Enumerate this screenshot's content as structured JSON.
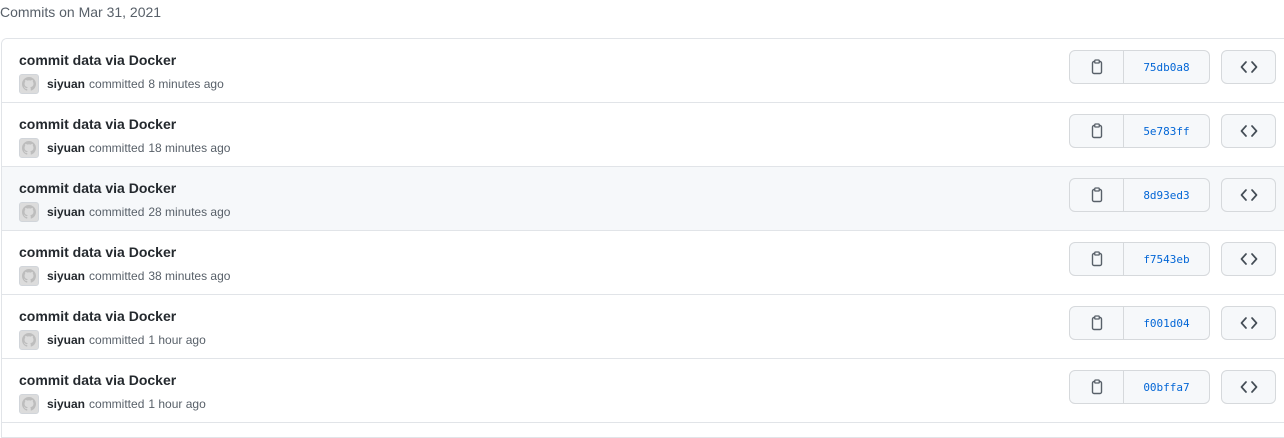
{
  "group": {
    "title": "Commits on Mar 31, 2021"
  },
  "colors": {
    "border": "#e1e4e8",
    "sha_link": "#0366d6",
    "muted_text": "#586069",
    "hover_row": "#f6f8fa"
  },
  "commits": [
    {
      "message": "commit data via Docker",
      "author": "siyuan",
      "verb": "committed",
      "time": "8 minutes ago",
      "sha": "75db0a8",
      "hovered": false
    },
    {
      "message": "commit data via Docker",
      "author": "siyuan",
      "verb": "committed",
      "time": "18 minutes ago",
      "sha": "5e783ff",
      "hovered": false
    },
    {
      "message": "commit data via Docker",
      "author": "siyuan",
      "verb": "committed",
      "time": "28 minutes ago",
      "sha": "8d93ed3",
      "hovered": true
    },
    {
      "message": "commit data via Docker",
      "author": "siyuan",
      "verb": "committed",
      "time": "38 minutes ago",
      "sha": "f7543eb",
      "hovered": false
    },
    {
      "message": "commit data via Docker",
      "author": "siyuan",
      "verb": "committed",
      "time": "1 hour ago",
      "sha": "f001d04",
      "hovered": false
    },
    {
      "message": "commit data via Docker",
      "author": "siyuan",
      "verb": "committed",
      "time": "1 hour ago",
      "sha": "00bffa7",
      "hovered": false
    }
  ],
  "icons": {
    "copy": "clipboard-icon",
    "browse": "code-icon",
    "avatar": "github-octocat-icon"
  }
}
